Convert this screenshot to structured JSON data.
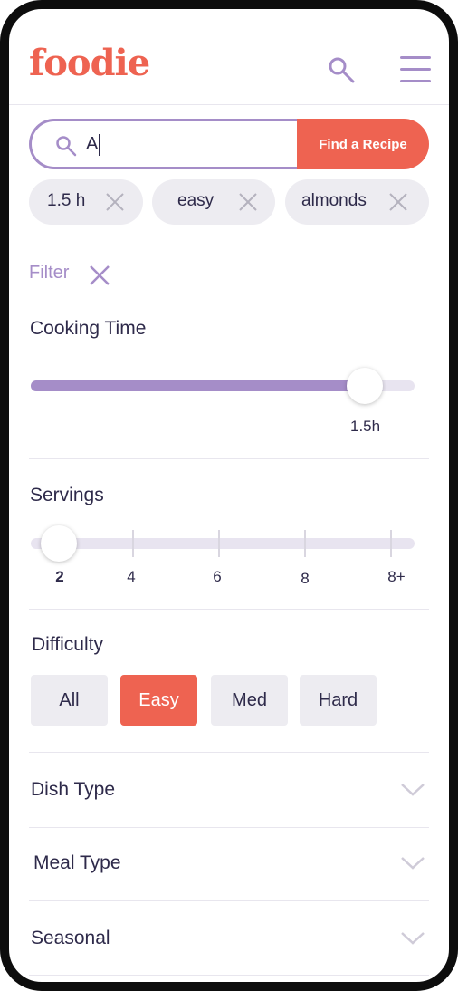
{
  "app": {
    "logo": "foodie"
  },
  "header": {
    "search_icon": "search-icon",
    "menu_icon": "hamburger-menu-icon"
  },
  "search": {
    "value": "A",
    "button_label": "Find a Recipe"
  },
  "chips": [
    {
      "label": "1.5 h"
    },
    {
      "label": "easy"
    },
    {
      "label": "almonds"
    }
  ],
  "filter": {
    "label": "Filter"
  },
  "cooking_time": {
    "title": "Cooking Time",
    "value_label": "1.5h",
    "fraction": 0.87
  },
  "servings": {
    "title": "Servings",
    "ticks": [
      "2",
      "4",
      "6",
      "8",
      "8+"
    ],
    "selected": "2"
  },
  "difficulty": {
    "title": "Difficulty",
    "options": [
      "All",
      "Easy",
      "Med",
      "Hard"
    ],
    "selected": "Easy"
  },
  "sections": {
    "dish_type": "Dish Type",
    "meal_type": "Meal Type",
    "seasonal": "Seasonal"
  },
  "colors": {
    "accent": "#ee6351",
    "purple": "#a58dc8",
    "text": "#2e2a4a",
    "chip_bg": "#edecf1"
  }
}
